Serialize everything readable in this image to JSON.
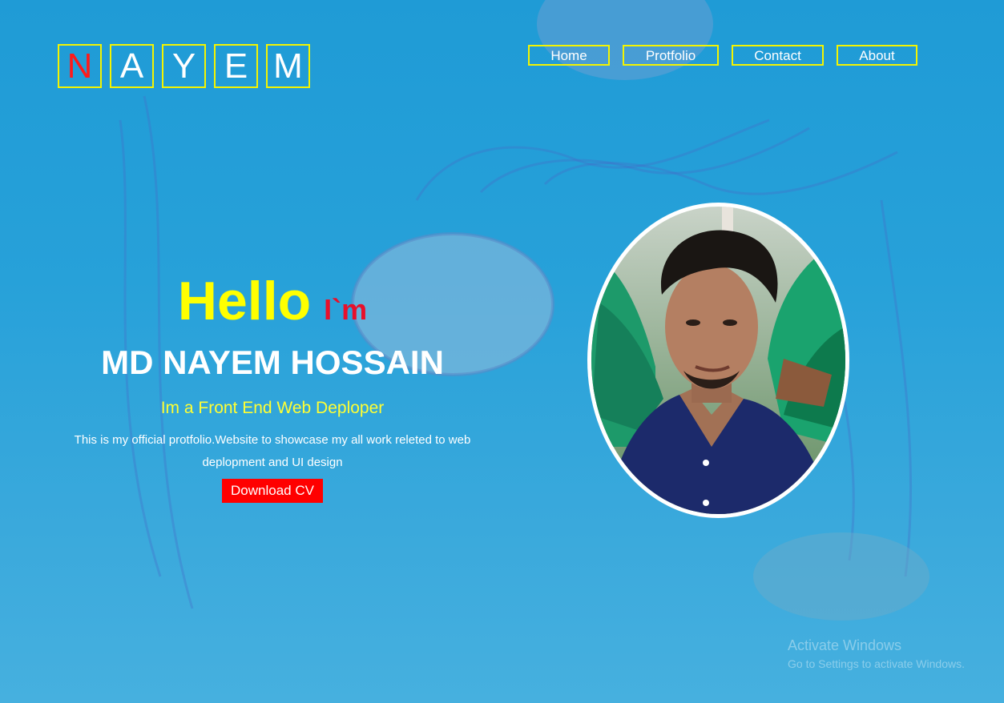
{
  "logo": {
    "letters": [
      "N",
      "A",
      "Y",
      "E",
      "M"
    ]
  },
  "nav": {
    "home": "Home",
    "portfolio": "Protfolio",
    "contact": "Contact",
    "about": "About"
  },
  "hero": {
    "hello": "Hello",
    "im": "I`m",
    "name": "MD NAYEM HOSSAIN",
    "role": "Im a Front End Web Deploper",
    "description": "This is my official protfolio.Website to showcase my all work releted to web deplopment and UI design",
    "download_button": "Download CV"
  },
  "watermark": {
    "title": "Activate Windows",
    "subtitle": "Go to Settings to activate Windows."
  },
  "colors": {
    "background": "#27a1d9",
    "accent_yellow": "#ffff00",
    "accent_red": "#ff0000",
    "border_yellow": "#f4f400",
    "text_white": "#ffffff"
  },
  "icons": {
    "portrait": "profile-photo"
  }
}
